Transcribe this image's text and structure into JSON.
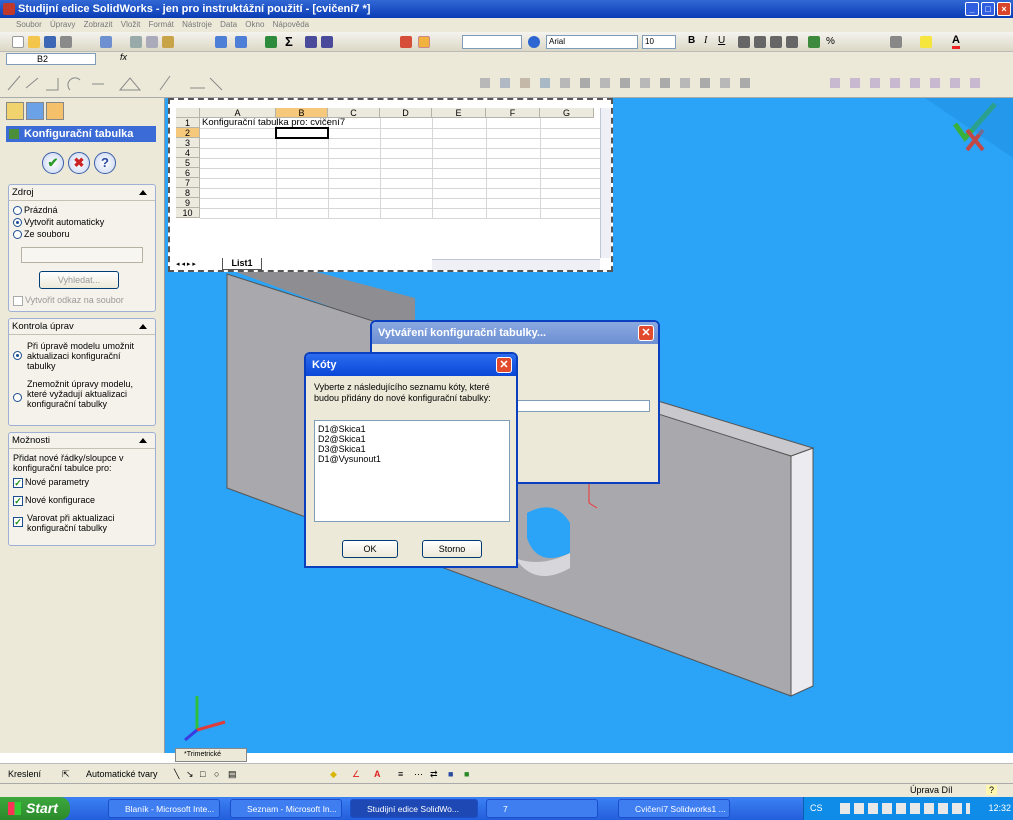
{
  "window": {
    "title": "Studijní edice SolidWorks - jen pro instruktážní použití - [cvičení7 *]"
  },
  "menu": [
    "Soubor",
    "Úpravy",
    "Zobrazit",
    "Vložit",
    "Formát",
    "Nástroje",
    "Data",
    "Okno",
    "Nápověda"
  ],
  "toolbar": {
    "font": "Arial",
    "size": "10",
    "zoom": ""
  },
  "formula": {
    "cell": "B2",
    "fx": "fx"
  },
  "panel": {
    "title": "Konfigurační tabulka",
    "ok": "✔",
    "cancel": "✖",
    "help": "?",
    "source": {
      "header": "Zdroj",
      "empty": "Prázdná",
      "auto": "Vytvořit automaticky",
      "file": "Ze souboru",
      "browse": "Vyhledat...",
      "link": "Vytvořit odkaz na soubor",
      "file_value": ""
    },
    "edit": {
      "header": "Kontrola úprav",
      "allow": "Při úpravě modelu umožnit aktualizaci konfigurační tabulky",
      "deny": "Znemožnit úpravy modelu, které vyžadují aktualizaci konfigurační tabulky"
    },
    "options": {
      "header": "Možnosti",
      "desc": "Přidat nové řádky/sloupce v konfigurační tabulce pro:",
      "params": "Nové parametry",
      "configs": "Nové konfigurace",
      "warn": "Varovat při aktualizaci konfigurační tabulky"
    }
  },
  "sheet": {
    "columns": [
      "A",
      "B",
      "C",
      "D",
      "E",
      "F",
      "G"
    ],
    "rows": [
      "1",
      "2",
      "3",
      "4",
      "5",
      "6",
      "7",
      "8",
      "9",
      "10"
    ],
    "a1": "Konfigurační tabulka pro: cvičení7",
    "tab": "List1"
  },
  "dialog_back": {
    "title": "Vytváření konfigurační tabulky..."
  },
  "dialog": {
    "title": "Kóty",
    "prompt": "Vyberte z následujícího seznamu kóty, které budou přidány do nové konfigurační tabulky:",
    "items": [
      "D1@Skica1",
      "D2@Skica1",
      "D3@Skica1",
      "D1@Vysunout1"
    ],
    "ok": "OK",
    "cancel": "Storno"
  },
  "view": {
    "label": "*Trimetrické"
  },
  "drawing": {
    "draw": "Kreslení",
    "autoshapes": "Automatické tvary"
  },
  "status": {
    "mode": "Úprava Díl",
    "help": "?"
  },
  "taskbar": {
    "start": "Start",
    "items": [
      "Blaník - Microsoft Inte...",
      "Seznam - Microsoft In...",
      "Studijní edice SolidWo...",
      "7",
      "Cvičení7 Solidworks1 ..."
    ],
    "lang": "CS",
    "clock": "12:32"
  },
  "colors": {
    "viewport": "#2ba3f6",
    "titlebar": "#0a3cb5",
    "taskbar": "#245edb"
  }
}
